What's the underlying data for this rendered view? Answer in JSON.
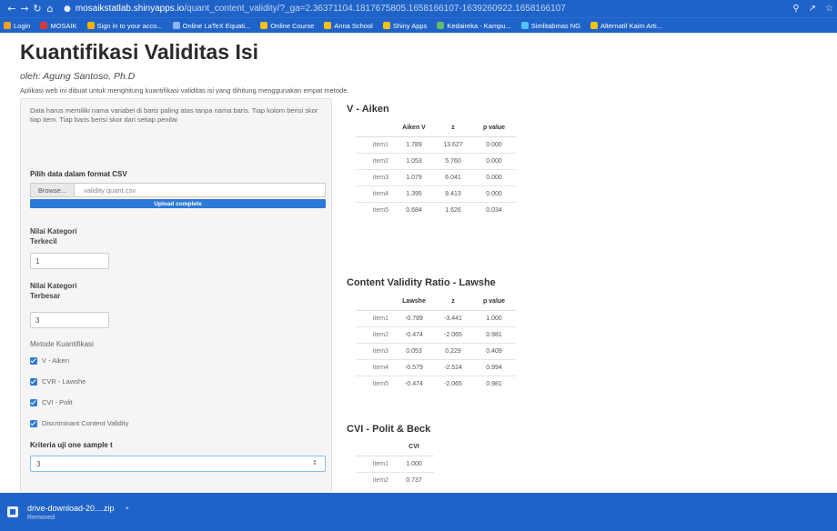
{
  "browser": {
    "url_host": "mosaikstatlab.shinyapps.io",
    "url_rest": "/quant_content_validity/?_ga=2.36371104.1817675805.1658166107-1639260922.1658166107",
    "bookmarks": [
      {
        "label": "Login",
        "color": "#f0a020"
      },
      {
        "label": "MOSAIK",
        "color": "#d83b3b"
      },
      {
        "label": "Sign in to your acco...",
        "color": "#f4b400"
      },
      {
        "label": "Online LaTeX Equati...",
        "color": "#8ab4f8"
      },
      {
        "label": "Online Course",
        "color": "#f4c20d"
      },
      {
        "label": "Anna School",
        "color": "#f4c20d"
      },
      {
        "label": "Shiny Apps",
        "color": "#f4c20d"
      },
      {
        "label": "Kedaireka - Kampu...",
        "color": "#66bb6a"
      },
      {
        "label": "Simlitabmas NG",
        "color": "#4fc3f7"
      },
      {
        "label": "Alternatif Kaim Arti...",
        "color": "#f4c20d"
      }
    ]
  },
  "page": {
    "title": "Kuantifikasi Validitas Isi",
    "author": "oleh: Agung Santoso, Ph.D",
    "description": "Aplikasi web ini dibuat untuk menghitung kuantifikasi validitas isi yang dihitung menggunakan empat metode."
  },
  "sidebar": {
    "note": "Data harus memiliki nama variabel di baris paling atas tanpa nama baris. Tiap kolom berisi skor tiap item. Tiap baris berisi skor dari setiap penilai",
    "file_label": "Pilih data dalam format CSV",
    "browse_label": "Browse...",
    "file_name": "validity quant.csv",
    "upload_status": "Upload complete",
    "min_label_1": "Nilai Kategori",
    "min_label_2": "Terkecil",
    "min_value": "1",
    "max_label_1": "Nilai Kategori",
    "max_label_2": "Terbesar",
    "max_value": "3",
    "method_label": "Metode Kuantifikasi",
    "methods": [
      "V - Aiken",
      "CVR - Lawshe",
      "CVI - Polit",
      "Discriminant Content Validity"
    ],
    "criteria_label": "Kriteria uji one sample t",
    "criteria_value": "3"
  },
  "aiken": {
    "title": "V - Aiken",
    "headers": [
      "",
      "Aiken V",
      "z",
      "p value"
    ],
    "rows": [
      [
        "item1",
        "1.789",
        "13.627",
        "0.000"
      ],
      [
        "item2",
        "1.053",
        "5.760",
        "0.000"
      ],
      [
        "item3",
        "1.079",
        "6.041",
        "0.000"
      ],
      [
        "item4",
        "1.395",
        "9.413",
        "0.000"
      ],
      [
        "item5",
        "0.684",
        "1.626",
        "0.034"
      ]
    ]
  },
  "lawshe": {
    "title": "Content Validity Ratio - Lawshe",
    "headers": [
      "",
      "Lawshe",
      "z",
      "p value"
    ],
    "rows": [
      [
        "item1",
        "-0.789",
        "-3.441",
        "1.000"
      ],
      [
        "item2",
        "-0.474",
        "-2.065",
        "0.981"
      ],
      [
        "item3",
        "0.053",
        "0.229",
        "0.409"
      ],
      [
        "item4",
        "-0.579",
        "-2.524",
        "0.994"
      ],
      [
        "item5",
        "-0.474",
        "-2.065",
        "0.981"
      ]
    ]
  },
  "cvi": {
    "title": "CVI - Polit & Beck",
    "headers": [
      "",
      "CVI"
    ],
    "rows": [
      [
        "item1",
        "1.000"
      ],
      [
        "item2",
        "0.737"
      ]
    ]
  },
  "download": {
    "name": "drive-download-20....zip",
    "status": "Removed"
  }
}
